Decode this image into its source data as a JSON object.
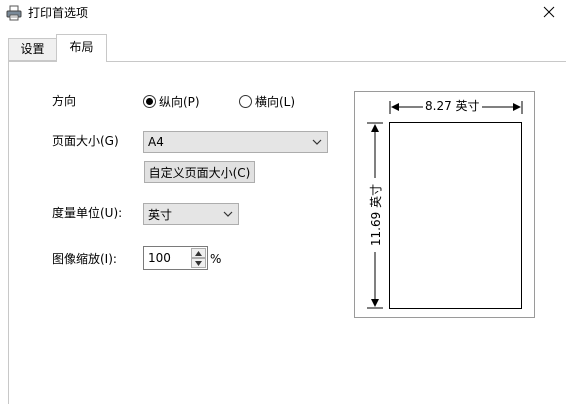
{
  "window": {
    "title": "打印首选项"
  },
  "tabs": [
    {
      "label": "设置",
      "selected": false
    },
    {
      "label": "布局",
      "selected": true
    }
  ],
  "layout": {
    "orientation": {
      "label": "方向",
      "options": [
        {
          "label": "纵向(P)",
          "selected": true
        },
        {
          "label": "横向(L)",
          "selected": false
        }
      ]
    },
    "page_size": {
      "label": "页面大小(G)",
      "value": "A4",
      "custom_button": "自定义页面大小(C)"
    },
    "units": {
      "label": "度量单位(U):",
      "value": "英寸"
    },
    "scale": {
      "label": "图像缩放(I):",
      "value": "100",
      "unit": "%"
    },
    "preview": {
      "width_label": "8.27 英寸",
      "height_label": "11.69 英寸"
    }
  },
  "icons": {
    "app": "printer-icon",
    "close": "close-icon",
    "dropdown": "chevron-down-icon",
    "spin_up": "spin-up-icon",
    "spin_down": "spin-down-icon"
  }
}
